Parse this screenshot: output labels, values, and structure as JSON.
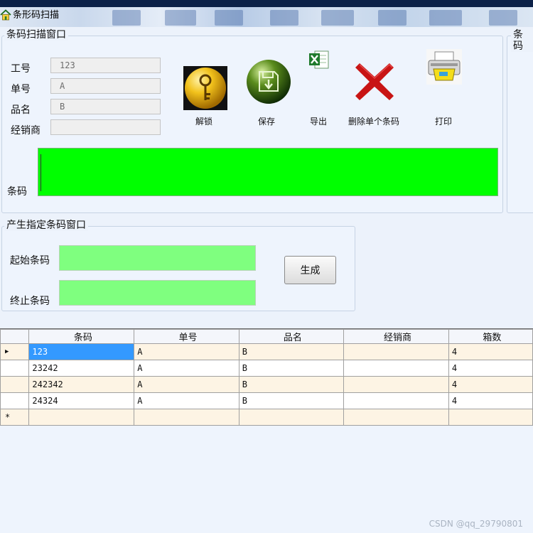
{
  "window": {
    "title": "条形码扫描"
  },
  "scan_group": {
    "title": "条码扫描窗口",
    "fields": [
      {
        "label": "工号",
        "value": "123"
      },
      {
        "label": "单号",
        "value": "A"
      },
      {
        "label": "品名",
        "value": "B"
      },
      {
        "label": "经销商",
        "value": ""
      }
    ],
    "toolbar": {
      "unlock": "解锁",
      "save": "保存",
      "export": "导出",
      "delete": "删除单个条码",
      "print": "打印"
    },
    "barcode_label": "条码",
    "barcode_value": ""
  },
  "right_group": {
    "title": "条码"
  },
  "generate_group": {
    "title": "产生指定条码窗口",
    "start_label": "起始条码",
    "end_label": "终止条码",
    "start_value": "",
    "end_value": "",
    "button": "生成"
  },
  "grid": {
    "columns": [
      "条码",
      "单号",
      "品名",
      "经销商",
      "箱数"
    ],
    "rows": [
      [
        "123",
        "A",
        "B",
        "",
        "4"
      ],
      [
        "23242",
        "A",
        "B",
        "",
        "4"
      ],
      [
        "242342",
        "A",
        "B",
        "",
        "4"
      ],
      [
        "24324",
        "A",
        "B",
        "",
        "4"
      ]
    ],
    "current_row_marker": "▶",
    "new_row_marker": "*"
  },
  "watermark": "CSDN @qq_29790801",
  "colors": {
    "barcode_input": "#00ff00",
    "range_inputs": "#7fff7f",
    "selected_cell": "#3399ff",
    "alt_row": "#fdf4e4"
  }
}
